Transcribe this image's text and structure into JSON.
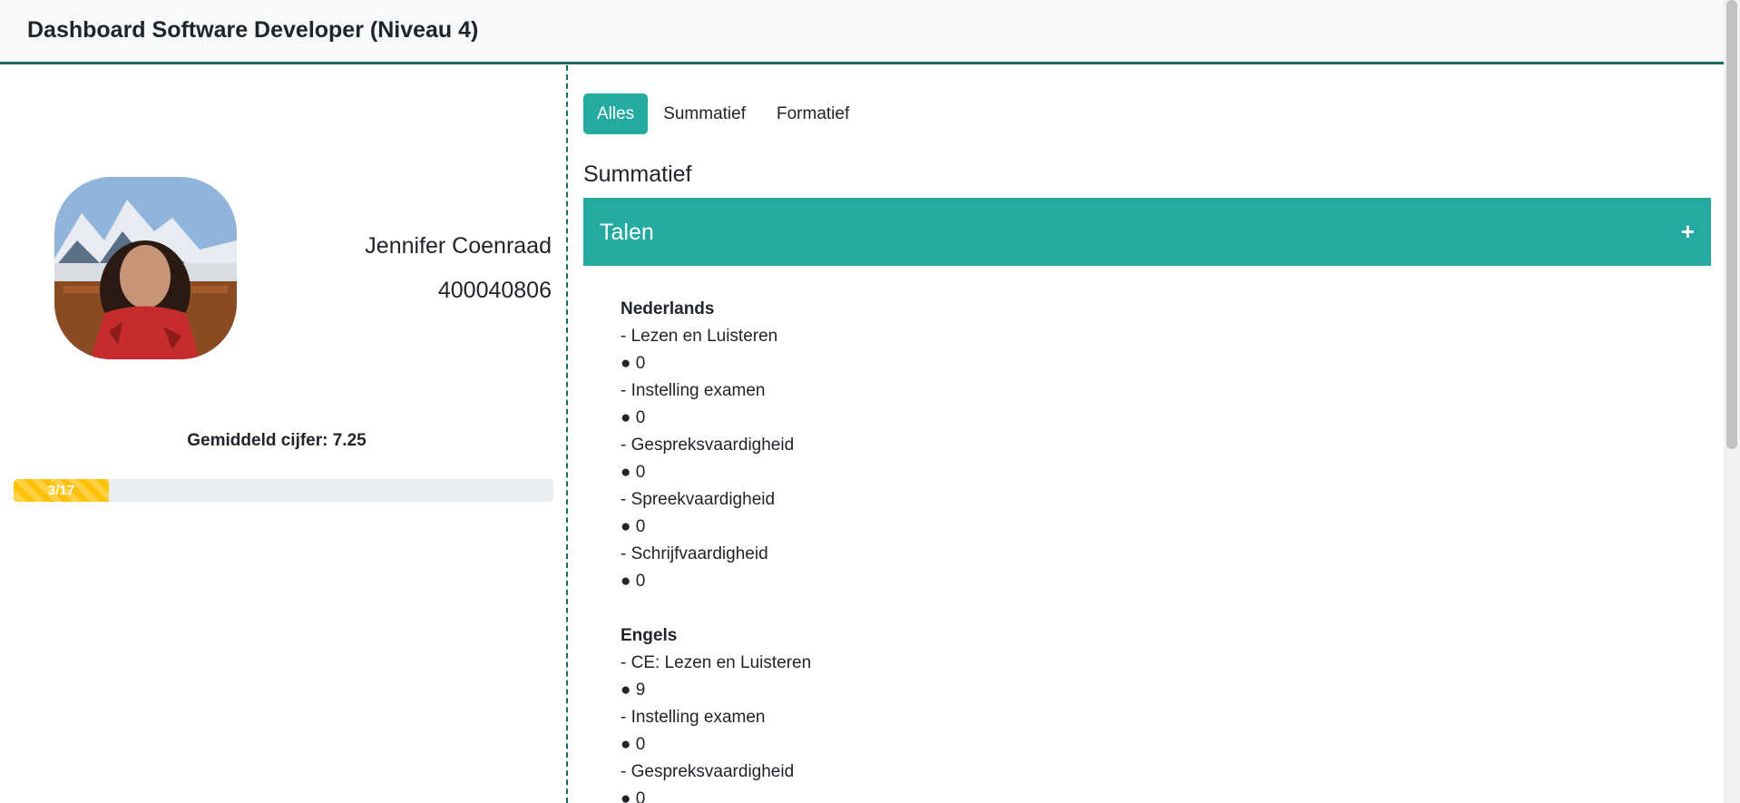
{
  "header": {
    "title": "Dashboard Software Developer (Niveau 4)"
  },
  "student": {
    "name": "Jennifer Coenraad",
    "number": "400040806",
    "average_label": "Gemiddeld cijfer: 7.25",
    "progress_label": "3/17",
    "progress_fraction": 0.1765
  },
  "tabs": [
    {
      "label": "Alles",
      "active": true
    },
    {
      "label": "Summatief",
      "active": false
    },
    {
      "label": "Formatief",
      "active": false
    }
  ],
  "section_title": "Summatief",
  "accordion": {
    "title": "Talen",
    "toggle": "+"
  },
  "subjects": [
    {
      "name": "Nederlands",
      "items": [
        {
          "label": "- Lezen en Luisteren",
          "grade": "● 0"
        },
        {
          "label": "- Instelling examen",
          "grade": "● 0"
        },
        {
          "label": "- Gespreksvaardigheid",
          "grade": "● 0"
        },
        {
          "label": "- Spreekvaardigheid",
          "grade": "● 0"
        },
        {
          "label": "- Schrijfvaardigheid",
          "grade": "● 0"
        }
      ]
    },
    {
      "name": "Engels",
      "items": [
        {
          "label": "- CE: Lezen en Luisteren",
          "grade": "● 9"
        },
        {
          "label": "- Instelling examen",
          "grade": "● 0"
        },
        {
          "label": "- Gespreksvaardigheid",
          "grade": "● 0"
        }
      ]
    }
  ],
  "colors": {
    "accent": "#24aaa0",
    "border": "#1c6e5e",
    "progress": "#ffc107"
  }
}
